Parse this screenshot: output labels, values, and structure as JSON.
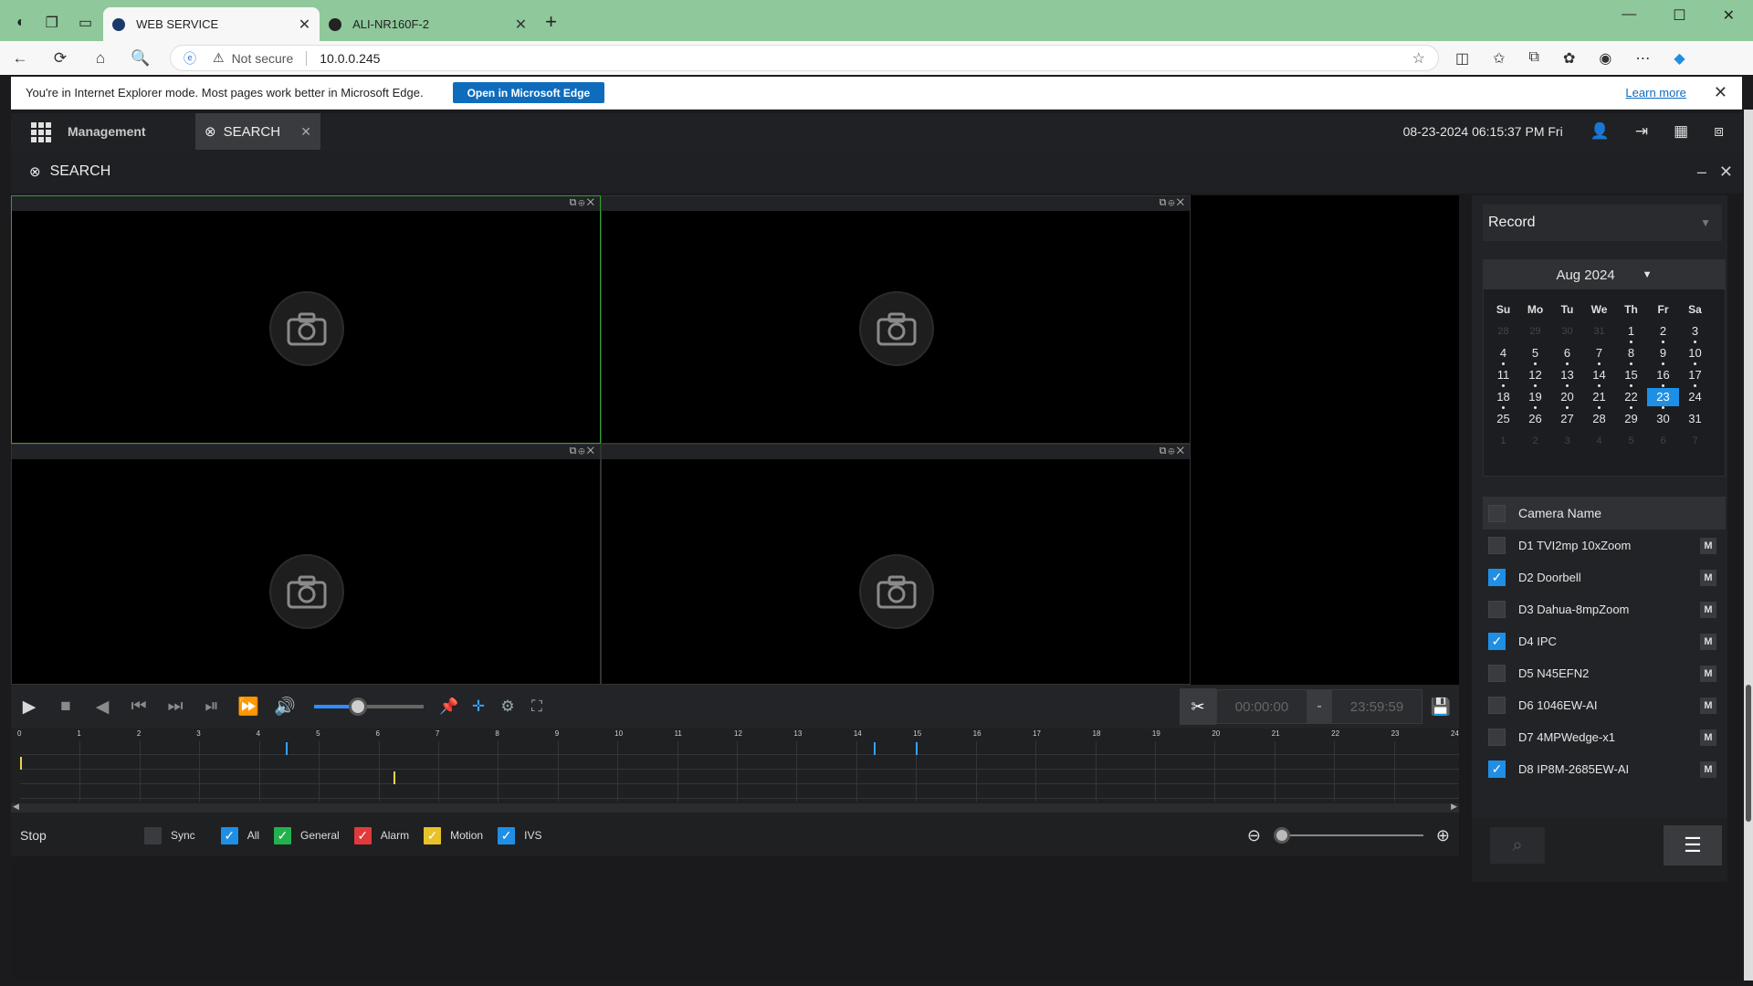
{
  "browser": {
    "tabs": [
      {
        "title": "WEB SERVICE",
        "close": "✕"
      },
      {
        "title": "ALI-NR160F-2",
        "close": "✕"
      }
    ],
    "new_tab": "+",
    "window_controls": [
      "—",
      "☐",
      "✕"
    ],
    "nav": [
      "←",
      "⟳",
      "⌂",
      "🔍"
    ],
    "security_label": "Not secure",
    "url": "10.0.0.245",
    "ie_mode_message": "You're in Internet Explorer mode. Most pages work better in Microsoft Edge.",
    "open_edge_label": "Open in Microsoft Edge",
    "learn_more_label": "Learn more"
  },
  "app": {
    "management_label": "Management",
    "search_tab_label": "SEARCH",
    "datetime": "08-23-2024 06:15:37 PM Fri",
    "panel_title": "SEARCH"
  },
  "controls": {
    "clip_start": "00:00:00",
    "clip_sep": "-",
    "clip_end": "23:59:59",
    "volume_percent": 40
  },
  "timeline": {
    "hours": [
      "0",
      "1",
      "2",
      "3",
      "4",
      "5",
      "6",
      "7",
      "8",
      "9",
      "10",
      "11",
      "12",
      "13",
      "14",
      "15",
      "16",
      "17",
      "18",
      "19",
      "20",
      "21",
      "22",
      "23",
      "24"
    ],
    "markers": [
      {
        "hour": 0.0,
        "row": 1,
        "color": "#e8d44d"
      },
      {
        "hour": 4.45,
        "row": 0,
        "color": "#3aa0ff"
      },
      {
        "hour": 6.25,
        "row": 2,
        "color": "#e8d44d"
      },
      {
        "hour": 14.3,
        "row": 0,
        "color": "#3aa0ff"
      },
      {
        "hour": 15.0,
        "row": 0,
        "color": "#3aa0ff"
      }
    ]
  },
  "legend": {
    "status": "Stop",
    "items": [
      {
        "label": "Sync",
        "color": "#3a3b3e",
        "checked": false
      },
      {
        "label": "All",
        "color": "#1f8fe6",
        "checked": true
      },
      {
        "label": "General",
        "color": "#22b14c",
        "checked": true
      },
      {
        "label": "Alarm",
        "color": "#e03a3a",
        "checked": true
      },
      {
        "label": "Motion",
        "color": "#e8c22a",
        "checked": true
      },
      {
        "label": "IVS",
        "color": "#1f8fe6",
        "checked": true
      }
    ]
  },
  "record_type": "Record",
  "calendar": {
    "month": "Aug 2024",
    "weekdays": [
      "Su",
      "Mo",
      "Tu",
      "We",
      "Th",
      "Fr",
      "Sa"
    ],
    "days": [
      {
        "d": "28",
        "o": true
      },
      {
        "d": "29",
        "o": true
      },
      {
        "d": "30",
        "o": true
      },
      {
        "d": "31",
        "o": true
      },
      {
        "d": "1",
        "dot": true
      },
      {
        "d": "2",
        "dot": true
      },
      {
        "d": "3",
        "dot": true
      },
      {
        "d": "4",
        "dot": true
      },
      {
        "d": "5",
        "dot": true
      },
      {
        "d": "6",
        "dot": true
      },
      {
        "d": "7",
        "dot": true
      },
      {
        "d": "8",
        "dot": true
      },
      {
        "d": "9",
        "dot": true
      },
      {
        "d": "10",
        "dot": true
      },
      {
        "d": "11",
        "dot": true
      },
      {
        "d": "12",
        "dot": true
      },
      {
        "d": "13",
        "dot": true
      },
      {
        "d": "14",
        "dot": true
      },
      {
        "d": "15",
        "dot": true
      },
      {
        "d": "16",
        "dot": true
      },
      {
        "d": "17",
        "dot": true
      },
      {
        "d": "18",
        "dot": true
      },
      {
        "d": "19",
        "dot": true
      },
      {
        "d": "20",
        "dot": true
      },
      {
        "d": "21",
        "dot": true
      },
      {
        "d": "22",
        "dot": true
      },
      {
        "d": "23",
        "dot": true,
        "today": true
      },
      {
        "d": "24"
      },
      {
        "d": "25"
      },
      {
        "d": "26"
      },
      {
        "d": "27"
      },
      {
        "d": "28"
      },
      {
        "d": "29"
      },
      {
        "d": "30"
      },
      {
        "d": "31"
      },
      {
        "d": "1",
        "o": true
      },
      {
        "d": "2",
        "o": true
      },
      {
        "d": "3",
        "o": true
      },
      {
        "d": "4",
        "o": true
      },
      {
        "d": "5",
        "o": true
      },
      {
        "d": "6",
        "o": true
      },
      {
        "d": "7",
        "o": true
      }
    ]
  },
  "cameras": {
    "header": "Camera Name",
    "m_label": "M",
    "list": [
      {
        "name": "D1 TVI2mp 10xZoom",
        "checked": false
      },
      {
        "name": "D2 Doorbell",
        "checked": true
      },
      {
        "name": "D3 Dahua-8mpZoom",
        "checked": false
      },
      {
        "name": "D4 IPC",
        "checked": true
      },
      {
        "name": "D5 N45EFN2",
        "checked": false
      },
      {
        "name": "D6 1046EW-AI",
        "checked": false
      },
      {
        "name": "D7 4MPWedge-x1",
        "checked": false
      },
      {
        "name": "D8 IP8M-2685EW-AI",
        "checked": true
      }
    ]
  }
}
